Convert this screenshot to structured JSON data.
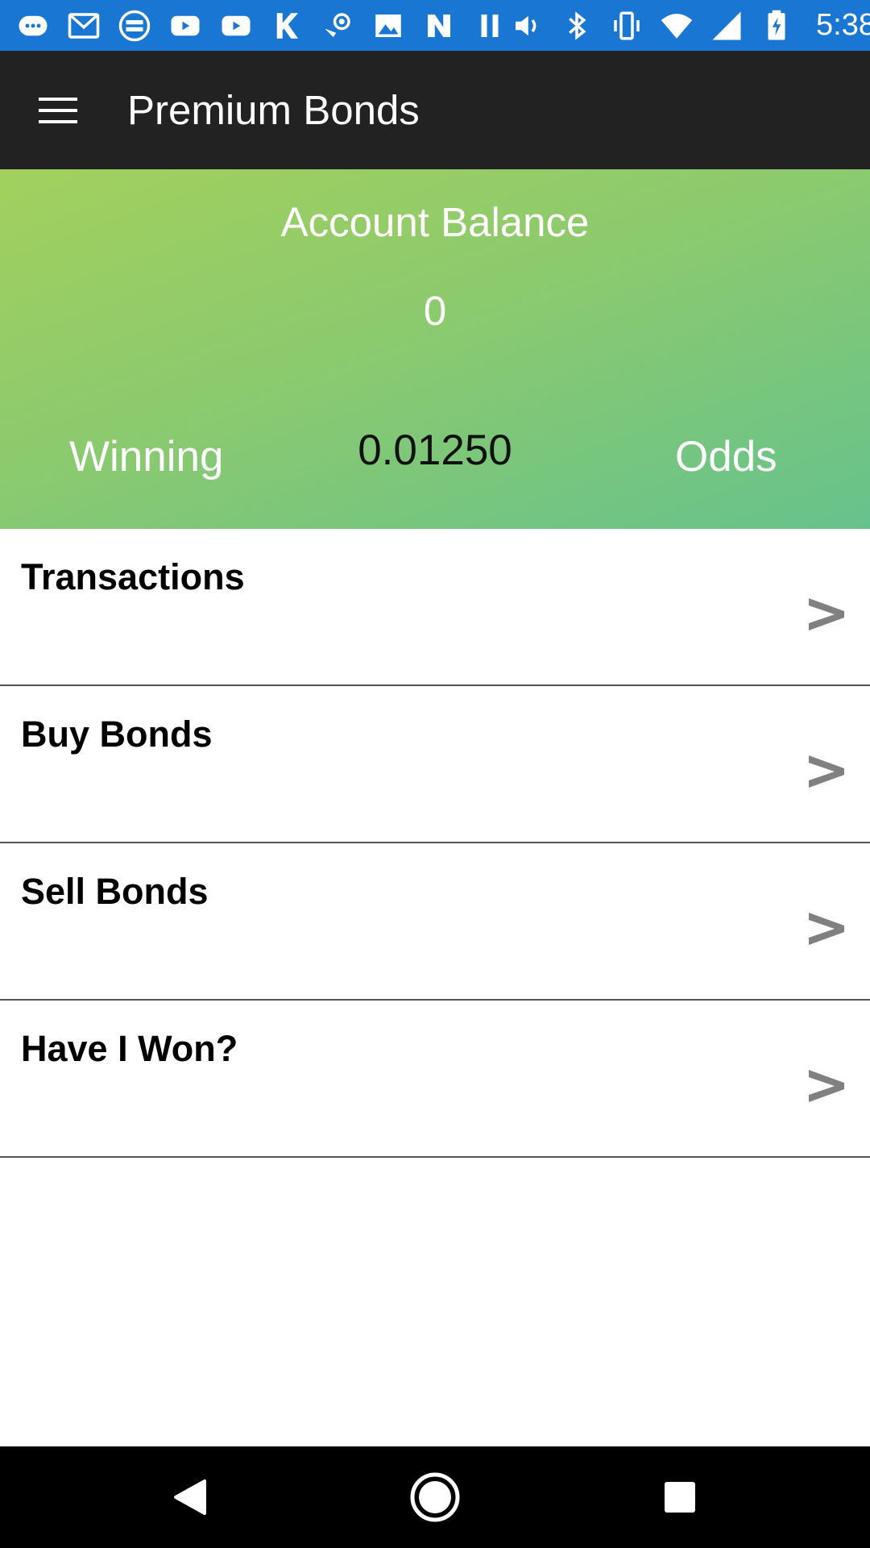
{
  "status_bar": {
    "time": "5:38",
    "left_icons": [
      "messages-icon",
      "gmail-icon",
      "webtoon-icon",
      "youtube-icon",
      "youtube-icon-2",
      "k-app-icon",
      "steam-icon",
      "gallery-icon",
      "n-app-icon",
      "pause-icon"
    ],
    "right_icons": [
      "volume-icon",
      "bluetooth-icon",
      "vibrate-icon",
      "wifi-icon",
      "signal-icon",
      "battery-charging-icon"
    ],
    "color": "#1976d2"
  },
  "app_bar": {
    "title": "Premium Bonds",
    "menu_icon": "hamburger-menu-icon",
    "color": "#222222"
  },
  "balance": {
    "label": "Account Balance",
    "value": "0",
    "winning_label": "Winning",
    "odds_value": "0.01250",
    "odds_label": "Odds",
    "gradient_start": "#a2d05d",
    "gradient_end": "#66c28c"
  },
  "menu": {
    "items": [
      {
        "label": "Transactions",
        "arrow": ">"
      },
      {
        "label": "Buy Bonds",
        "arrow": ">"
      },
      {
        "label": "Sell Bonds",
        "arrow": ">"
      },
      {
        "label": "Have I Won?",
        "arrow": ">"
      }
    ],
    "arrow_color": "#808080"
  },
  "nav_bar": {
    "buttons": [
      "back-icon",
      "home-icon",
      "recents-icon"
    ]
  }
}
